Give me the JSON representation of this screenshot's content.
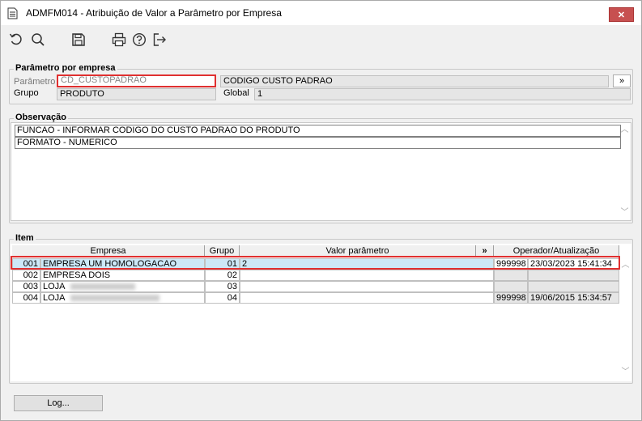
{
  "window": {
    "title": "ADMFM014 - Atribuição de Valor a Parâmetro por Empresa",
    "close_glyph": "✕"
  },
  "toolbar": {
    "icons": [
      "undo-icon",
      "search-icon",
      "save-icon",
      "print-icon",
      "help-icon",
      "exit-icon"
    ]
  },
  "param": {
    "section_title": "Parâmetro por empresa",
    "parametro_label": "Parâmetro",
    "parametro_value": "CD_CUSTOPADRAO",
    "descricao_value": "CODIGO CUSTO PADRAO",
    "lookup_button": "»",
    "grupo_label": "Grupo",
    "grupo_value": "PRODUTO",
    "global_label": "Global",
    "global_value": "1"
  },
  "observacao": {
    "section_title": "Observação",
    "lines": [
      "FUNCAO -  INFORMAR CODIGO DO CUSTO PADRAO DO PRODUTO",
      "FORMATO - NUMERICO"
    ]
  },
  "item": {
    "section_title": "Item",
    "headers": {
      "empresa": "Empresa",
      "grupo": "Grupo",
      "valor": "Valor parâmetro",
      "valor_button": "»",
      "operador": "Operador/Atualização"
    },
    "rows": [
      {
        "code": "001",
        "name": "EMPRESA UM HOMOLOGACAO",
        "grupo": "01",
        "valor": "2",
        "operador": "999998",
        "atualizacao": "23/03/2023 15:41:34"
      },
      {
        "code": "002",
        "name": "EMPRESA DOIS",
        "grupo": "02",
        "valor": "",
        "operador": "",
        "atualizacao": ""
      },
      {
        "code": "003",
        "name": "LOJA",
        "grupo": "03",
        "valor": "",
        "operador": "",
        "atualizacao": ""
      },
      {
        "code": "004",
        "name": "LOJA",
        "grupo": "04",
        "valor": "",
        "operador": "999998",
        "atualizacao": "19/06/2015 15:34:57"
      }
    ]
  },
  "footer": {
    "log_button": "Log..."
  },
  "colors": {
    "highlight_border": "#e03030",
    "selected_row": "#cde8f7",
    "close_button": "#c75050"
  }
}
